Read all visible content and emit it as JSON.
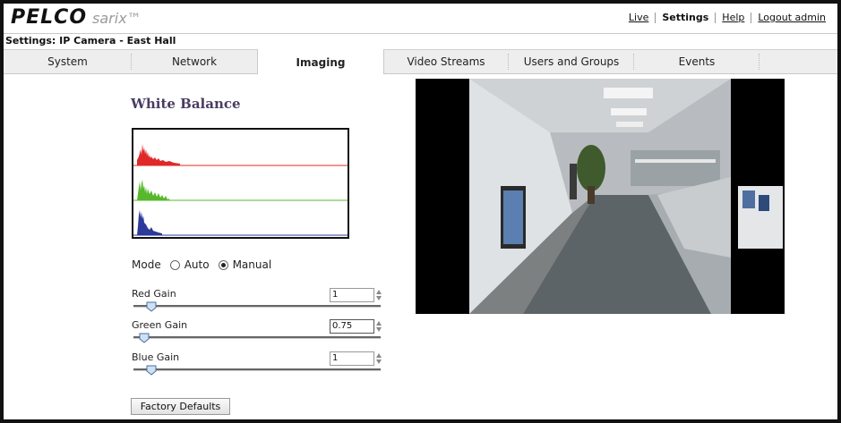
{
  "header": {
    "logo_main": "PELCO",
    "logo_sub": "sarix™",
    "nav": [
      {
        "label": "Live",
        "active": false
      },
      {
        "label": "Settings",
        "active": true
      },
      {
        "label": "Help",
        "active": false
      },
      {
        "label": "Logout admin",
        "active": false
      }
    ]
  },
  "page_title": "Settings: IP Camera - East Hall",
  "tabs": [
    {
      "label": "System",
      "selected": false
    },
    {
      "label": "Network",
      "selected": false
    },
    {
      "label": "Imaging",
      "selected": true
    },
    {
      "label": "Video Streams",
      "selected": false
    },
    {
      "label": "Users and Groups",
      "selected": false
    },
    {
      "label": "Events",
      "selected": false
    }
  ],
  "white_balance": {
    "title": "White Balance",
    "histogram_colors": {
      "red": "#e02828",
      "green": "#56b82a",
      "blue": "#2c3a9a"
    },
    "mode": {
      "label": "Mode",
      "options": [
        "Auto",
        "Manual"
      ],
      "selected": "Manual"
    },
    "gains": [
      {
        "label": "Red Gain",
        "value": "1",
        "slider_fraction": 0.08
      },
      {
        "label": "Green Gain",
        "value": "0.75",
        "slider_fraction": 0.04
      },
      {
        "label": "Blue Gain",
        "value": "1",
        "slider_fraction": 0.08
      }
    ],
    "factory_defaults_label": "Factory Defaults"
  },
  "video": {
    "description_icon": "camera-feed-image"
  },
  "colors": {
    "accent_title": "#4b3c63",
    "tab_bar": "#eeeeee"
  }
}
